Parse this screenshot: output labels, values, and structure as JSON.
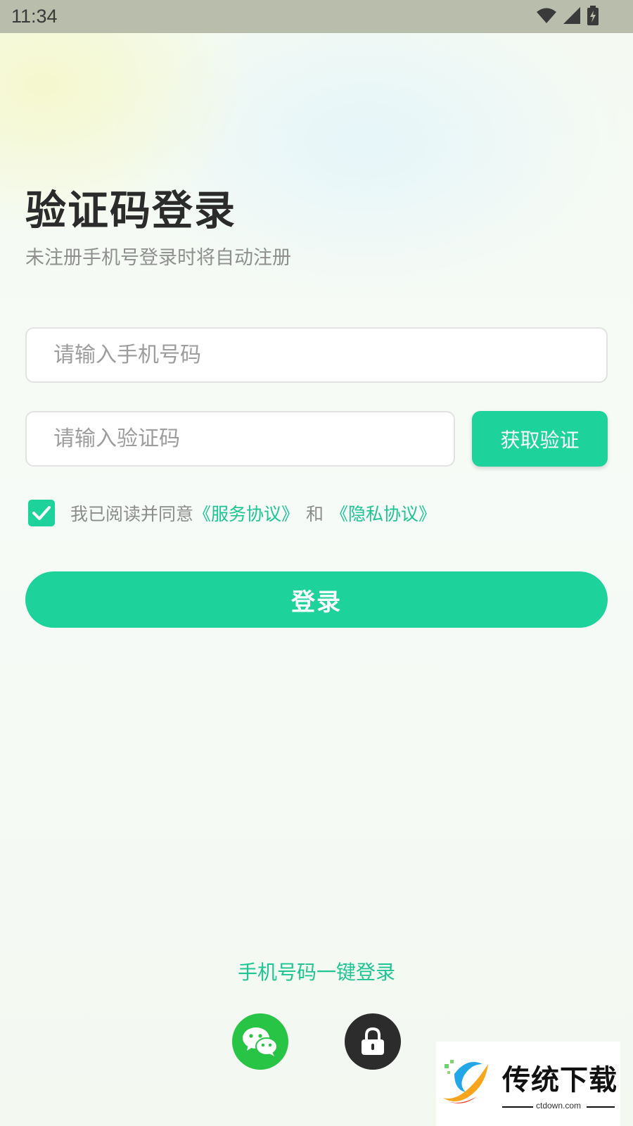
{
  "status_bar": {
    "time": "11:34"
  },
  "page": {
    "title": "验证码登录",
    "subtitle": "未注册手机号登录时将自动注册"
  },
  "form": {
    "phone_placeholder": "请输入手机号码",
    "code_placeholder": "请输入验证码",
    "get_code_label": "获取验证",
    "agree_checked": true,
    "agree_prefix": "我已阅读并同意",
    "service_link": "《服务协议》",
    "and_text": "和",
    "privacy_link": "《隐私协议》",
    "login_label": "登录"
  },
  "alt_login": {
    "one_key_label": "手机号码一键登录",
    "icons": [
      "wechat-icon",
      "lock-icon"
    ]
  },
  "watermark": {
    "brand": "传统下载",
    "url": "ctdown.com"
  },
  "colors": {
    "accent": "#1dd39b",
    "link": "#1dc593",
    "wechat": "#28c445",
    "lock_bg": "#2c2c2c"
  }
}
